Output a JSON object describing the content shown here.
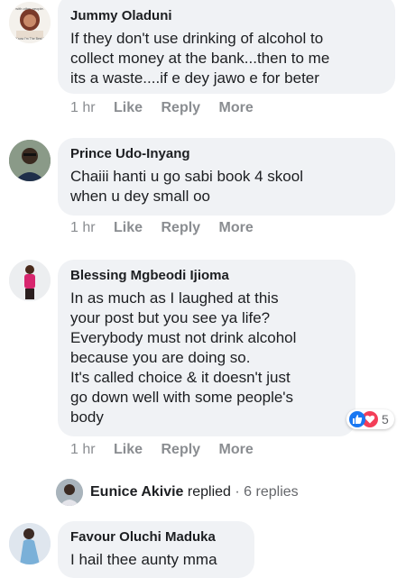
{
  "comments": [
    {
      "author": "Jummy Oladuni",
      "text": [
        "If they don't use drinking of alcohol to",
        "collect money at the bank...then to me",
        "its a waste....if e dey jawo e for beter"
      ],
      "time": "1 hr",
      "like": "Like",
      "reply": "Reply",
      "more": "More",
      "avatar_caption_top": "with other people.",
      "avatar_caption_bottom": "Know I'm The Best !"
    },
    {
      "author": "Prince Udo-Inyang",
      "text": [
        "Chaiii hanti u go sabi book 4 skool",
        "when u dey small oo"
      ],
      "time": "1 hr",
      "like": "Like",
      "reply": "Reply",
      "more": "More"
    },
    {
      "author": "Blessing Mgbeodi Ijioma",
      "text": [
        "In as much as I laughed at this",
        "your post but you see ya life?",
        "Everybody must not drink alcohol",
        "because you are doing so.",
        "It's called choice & it doesn't just",
        "go down well with some people's",
        "body"
      ],
      "time": "1 hr",
      "like": "Like",
      "reply": "Reply",
      "more": "More",
      "reaction_count": "5",
      "reaction_icons": [
        "like-icon",
        "love-icon"
      ]
    },
    {
      "author": "Favour Oluchi Maduka",
      "text": [
        "I hail thee aunty mma"
      ]
    }
  ],
  "replies_summary": {
    "name": "Eunice Akivie",
    "action": "replied",
    "separator": "·",
    "count": "6 replies"
  },
  "colors": {
    "bubble": "#f0f2f5",
    "meta": "#8a8d91",
    "like_blue": "#1877f2",
    "love_red": "#f33e58"
  }
}
